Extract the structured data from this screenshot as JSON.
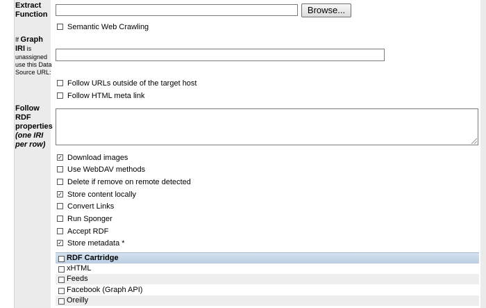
{
  "labels": {
    "extract_function_1": "Extract",
    "extract_function_2": "Function",
    "graph_iri_1_a": "If",
    "graph_iri_1_b": "Graph",
    "graph_iri_2_a": "IRI",
    "graph_iri_2_b": "is",
    "graph_iri_3": "unassigned",
    "graph_iri_4": "use this Data",
    "graph_iri_5": "Source URL:",
    "follow_rdf_1": "Follow",
    "follow_rdf_2": "RDF",
    "follow_rdf_3": "properties",
    "follow_rdf_4": "(one IRI",
    "follow_rdf_5": "per row)"
  },
  "inputs": {
    "extract_function_value": "",
    "graph_iri_value": "",
    "follow_rdf_value": ""
  },
  "browse_label": "Browse...",
  "options": [
    {
      "label": "Semantic Web Crawling",
      "checked": false
    },
    {
      "label": "Follow URLs outside of the target host",
      "checked": false
    },
    {
      "label": "Follow HTML meta link",
      "checked": false
    },
    {
      "label": "Download images",
      "checked": true
    },
    {
      "label": "Use WebDAV methods",
      "checked": false
    },
    {
      "label": "Delete if remove on remote detected",
      "checked": false
    },
    {
      "label": "Store content locally",
      "checked": true
    },
    {
      "label": "Convert Links",
      "checked": false
    },
    {
      "label": "Run Sponger",
      "checked": false
    },
    {
      "label": "Accept RDF",
      "checked": false
    },
    {
      "label": "Store metadata *",
      "checked": true
    }
  ],
  "cartridge_header": {
    "label": "RDF Cartridge",
    "checked": false
  },
  "cartridges": [
    {
      "label": "xHTML",
      "checked": false
    },
    {
      "label": "Feeds",
      "checked": false
    },
    {
      "label": "Facebook (Graph API)",
      "checked": false
    },
    {
      "label": "Oreilly",
      "checked": false
    }
  ],
  "check_mark": "✓"
}
